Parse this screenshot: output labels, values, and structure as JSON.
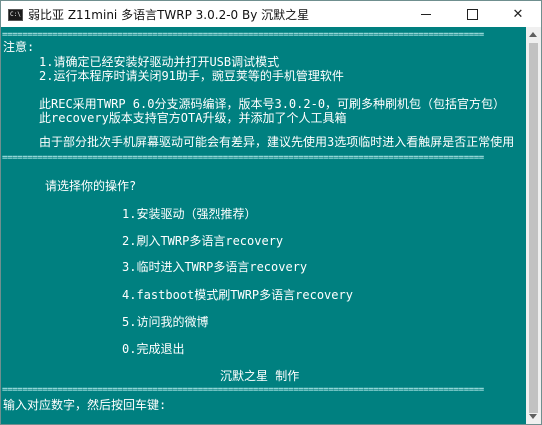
{
  "window": {
    "title": "弱比亚 Z11mini 多语言TWRP 3.0.2-0 By 沉默之星",
    "icon_text": "C:\\"
  },
  "console": {
    "separator": "================================================================================================",
    "note_label": "注意:",
    "notes": [
      "1.请确定已经安装好驱动并打开USB调试模式",
      "2.运行本程序时请关闭91助手，豌豆荚等的手机管理软件"
    ],
    "info": [
      "此REC采用TWRP 6.0分支源码编译，版本号3.0.2-0，可刷多种刷机包（包括官方包）",
      "此recovery版本支持官方OTA升级，并添加了个人工具箱"
    ],
    "warning": "由于部分批次手机屏幕驱动可能会有差异，建议先使用3选项临时进入看触屏是否正常使用",
    "prompt": "请选择你的操作?",
    "menu": [
      "1.安装驱动（强烈推荐）",
      "2.刷入TWRP多语言recovery",
      "3.临时进入TWRP多语言recovery",
      "4.fastboot模式刷TWRP多语言recovery",
      "5.访问我的微博",
      "0.完成退出"
    ],
    "credit": "沉默之星 制作",
    "input_prompt": "输入对应数字，然后按回车键:"
  }
}
